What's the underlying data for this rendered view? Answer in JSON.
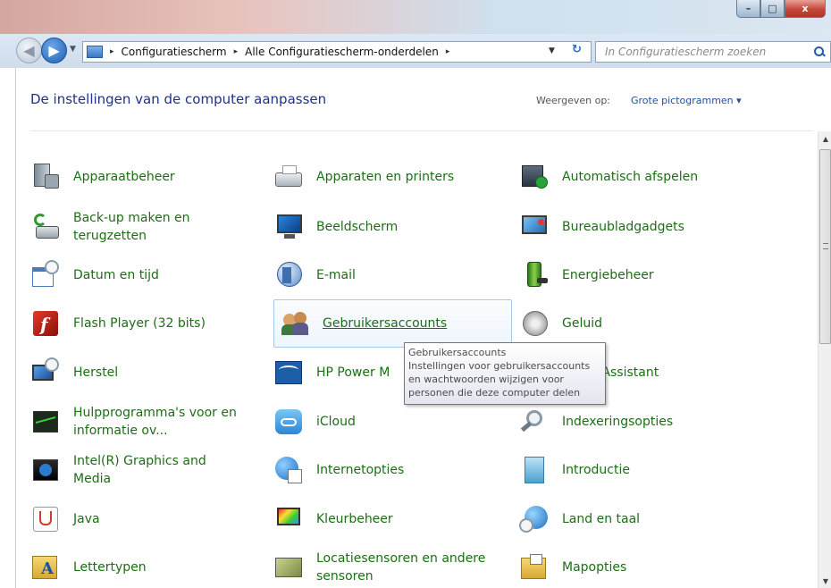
{
  "window": {
    "controls": {
      "minimize": "–",
      "maximize": "□",
      "close": "x"
    }
  },
  "address": {
    "back_glyph": "◀",
    "forward_glyph": "▶",
    "breadcrumbs": [
      "Configuratiescherm",
      "Alle Configuratiescherm-onderdelen"
    ],
    "separator": "▸",
    "search_placeholder": "In Configuratiescherm zoeken"
  },
  "header": {
    "title": "De instellingen van de computer aanpassen",
    "view_label": "Weergeven op:",
    "view_value": "Grote pictogrammen"
  },
  "items": [
    {
      "label": "Apparaatbeheer",
      "icon": "device-manager-icon"
    },
    {
      "label": "Apparaten en printers",
      "icon": "printer-icon"
    },
    {
      "label": "Automatisch afspelen",
      "icon": "autoplay-icon"
    },
    {
      "label": "Back-up maken en terugzetten",
      "icon": "backup-icon"
    },
    {
      "label": "Beeldscherm",
      "icon": "monitor-icon"
    },
    {
      "label": "Bureaubladgadgets",
      "icon": "gadgets-icon"
    },
    {
      "label": "Datum en tijd",
      "icon": "calendar-clock-icon"
    },
    {
      "label": "E-mail",
      "icon": "mail-icon"
    },
    {
      "label": "Energiebeheer",
      "icon": "battery-icon"
    },
    {
      "label": "Flash Player (32 bits)",
      "icon": "flash-icon"
    },
    {
      "label": "Gebruikersaccounts",
      "icon": "users-icon"
    },
    {
      "label": "Geluid",
      "icon": "speaker-icon"
    },
    {
      "label": "Herstel",
      "icon": "recovery-icon"
    },
    {
      "label": "HP Power M",
      "icon": "energy-star-icon"
    },
    {
      "label": "curity Assistant",
      "icon": "security-icon"
    },
    {
      "label": "Hulpprogramma's voor en informatie ov...",
      "icon": "performance-icon"
    },
    {
      "label": "iCloud",
      "icon": "cloud-icon"
    },
    {
      "label": "Indexeringsopties",
      "icon": "magnifier-icon"
    },
    {
      "label": "Intel(R) Graphics and Media",
      "icon": "intel-icon"
    },
    {
      "label": "Internetopties",
      "icon": "globe-icon"
    },
    {
      "label": "Introductie",
      "icon": "getting-started-icon"
    },
    {
      "label": "Java",
      "icon": "java-icon"
    },
    {
      "label": "Kleurbeheer",
      "icon": "color-icon"
    },
    {
      "label": "Land en taal",
      "icon": "region-icon"
    },
    {
      "label": "Lettertypen",
      "icon": "fonts-icon"
    },
    {
      "label": "Locatiesensoren en andere sensoren",
      "icon": "location-icon"
    },
    {
      "label": "Mapopties",
      "icon": "folder-options-icon"
    }
  ],
  "tooltip": {
    "title": "Gebruikersaccounts",
    "line1": "Instellingen voor gebruikersaccounts",
    "line2": "en wachtwoorden wijzigen voor",
    "line3": "personen die deze computer delen"
  },
  "scrollbar": {
    "up": "▲",
    "down": "▼"
  }
}
